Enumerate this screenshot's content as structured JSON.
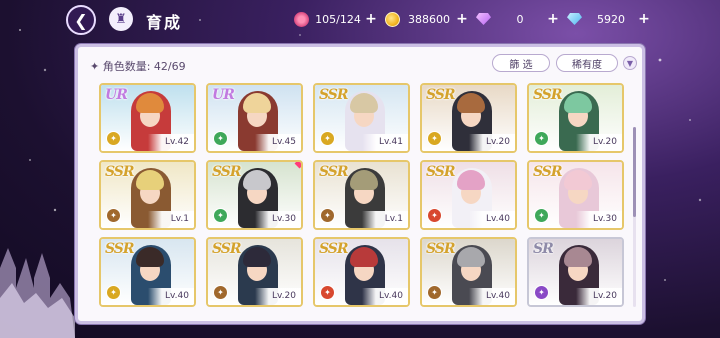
{
  "header": {
    "back_icon": "back-arrow-icon",
    "home_icon": "castle-home-icon",
    "title": "育成"
  },
  "resources": [
    {
      "name": "stamina",
      "icon": "candy-icon",
      "value": "105/124"
    },
    {
      "name": "gold",
      "icon": "coin-icon",
      "value": "388600"
    },
    {
      "name": "paid-gems",
      "icon": "pink-diamond-icon",
      "value": "0"
    },
    {
      "name": "free-gems",
      "icon": "blue-diamond-icon",
      "value": "5920"
    }
  ],
  "panel": {
    "count_label": "✦ 角色数量: 42/69",
    "filter_label": "篩 选",
    "rarity_label": "稀有度",
    "sort_icon": "sort-arrow-icon"
  },
  "colors": {
    "panel_bg": "#faf8fc",
    "ssr_border": "#e6c76a",
    "ur_text": "#c17be0",
    "ssr_text": "#d4a22c",
    "sr_text": "#8e8aa8",
    "new_dot": "#ff3b7a"
  },
  "cards": [
    {
      "rarity": "UR",
      "level": "Lv.42",
      "attr": "yellow",
      "hair": "#e08a3c",
      "outfit": "#c63b3b",
      "bg": "#bfe0ee"
    },
    {
      "rarity": "UR",
      "level": "Lv.45",
      "attr": "green",
      "hair": "#efd49a",
      "outfit": "#8a3a30",
      "bg": "#cfe2f1"
    },
    {
      "rarity": "SSR",
      "level": "Lv.41",
      "attr": "yellow",
      "hair": "#d8c8a4",
      "outfit": "#e6e2ef",
      "bg": "#d5e6f2"
    },
    {
      "rarity": "SSR",
      "level": "Lv.20",
      "attr": "yellow",
      "hair": "#a86a3e",
      "outfit": "#2f2f3a",
      "bg": "#e8d9c6"
    },
    {
      "rarity": "SSR",
      "level": "Lv.20",
      "attr": "green",
      "hair": "#7dc8a0",
      "outfit": "#3a6a50",
      "bg": "#e3eed8"
    },
    {
      "rarity": "SSR",
      "level": "Lv.1",
      "attr": "brown",
      "hair": "#e7d07a",
      "outfit": "#8a5a32",
      "bg": "#f0e7c6"
    },
    {
      "rarity": "SSR",
      "level": "Lv.30",
      "attr": "green",
      "hair": "#c8c8cc",
      "outfit": "#2c2c30",
      "bg": "#d6e3cf",
      "new": true
    },
    {
      "rarity": "SSR",
      "level": "Lv.1",
      "attr": "brown",
      "hair": "#a49c78",
      "outfit": "#3b3b3b",
      "bg": "#e9e2d2"
    },
    {
      "rarity": "SSR",
      "level": "Lv.40",
      "attr": "red",
      "hair": "#e4a2c6",
      "outfit": "#f2f0f6",
      "bg": "#efdfe6"
    },
    {
      "rarity": "SSR",
      "level": "Lv.30",
      "attr": "green",
      "hair": "#f2c9d4",
      "outfit": "#e8c8d8",
      "bg": "#f6e5ea"
    },
    {
      "rarity": "SSR",
      "level": "Lv.40",
      "attr": "yellow",
      "hair": "#3a2a28",
      "outfit": "#2b4d6e",
      "bg": "#d8e6f0"
    },
    {
      "rarity": "SSR",
      "level": "Lv.20",
      "attr": "brown",
      "hair": "#2d2a3a",
      "outfit": "#2b3a4e",
      "bg": "#e6e4dc"
    },
    {
      "rarity": "SSR",
      "level": "Lv.40",
      "attr": "red",
      "hair": "#b83a3a",
      "outfit": "#2f3448",
      "bg": "#e6e2ea"
    },
    {
      "rarity": "SSR",
      "level": "Lv.40",
      "attr": "brown",
      "hair": "#a8a8ac",
      "outfit": "#4a4a52",
      "bg": "#dcd7cc"
    },
    {
      "rarity": "SR",
      "level": "Lv.20",
      "attr": "purple",
      "hair": "#a88892",
      "outfit": "#3a2a3a",
      "bg": "#dcd4dc"
    }
  ]
}
